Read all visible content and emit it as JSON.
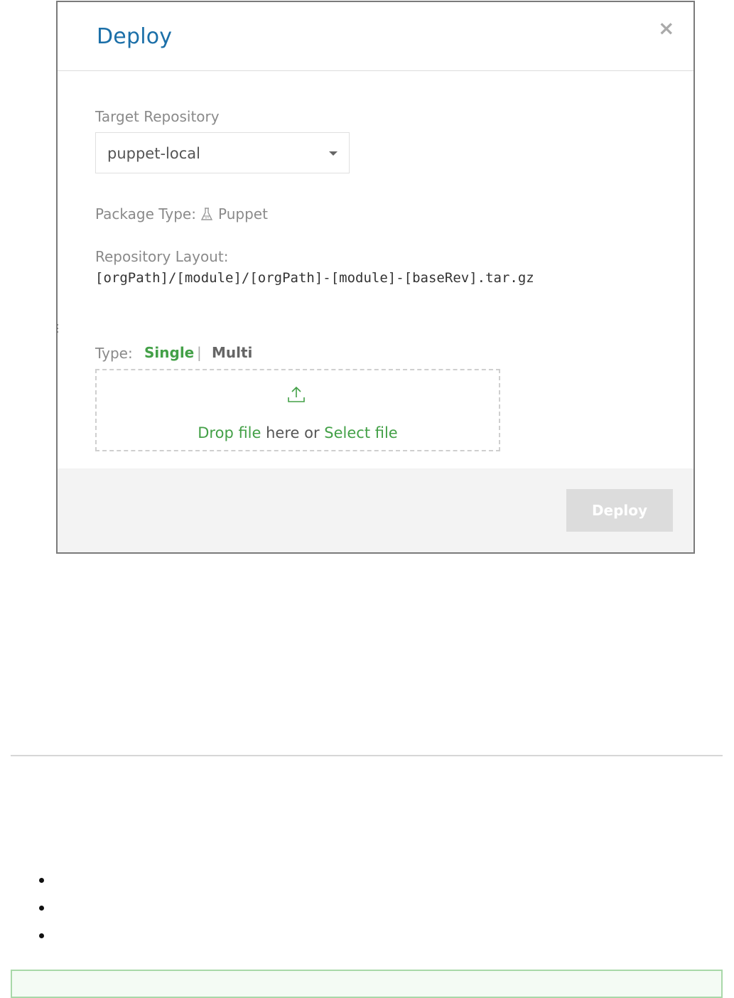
{
  "modal": {
    "title": "Deploy",
    "close_icon": "×",
    "target_repository_label": "Target Repository",
    "target_repository_value": "puppet-local",
    "package_type_label": "Package Type:",
    "package_type_value": "Puppet",
    "package_type_icon": "flask-icon",
    "repository_layout_label": "Repository Layout:",
    "repository_layout_value": "[orgPath]/[module]/[orgPath]-[module]-[baseRev].tar.gz",
    "type_label": "Type:",
    "type_options": [
      "Single",
      "Multi"
    ],
    "type_selected": "Single",
    "type_separator": "|",
    "dropzone": {
      "drop_link": "Drop file",
      "middle_text": " here or ",
      "select_link": "Select file"
    },
    "deploy_button": "Deploy"
  },
  "colors": {
    "title": "#1b6fa8",
    "accent_green": "#43a047",
    "disabled_button": "#dcdcdc"
  }
}
